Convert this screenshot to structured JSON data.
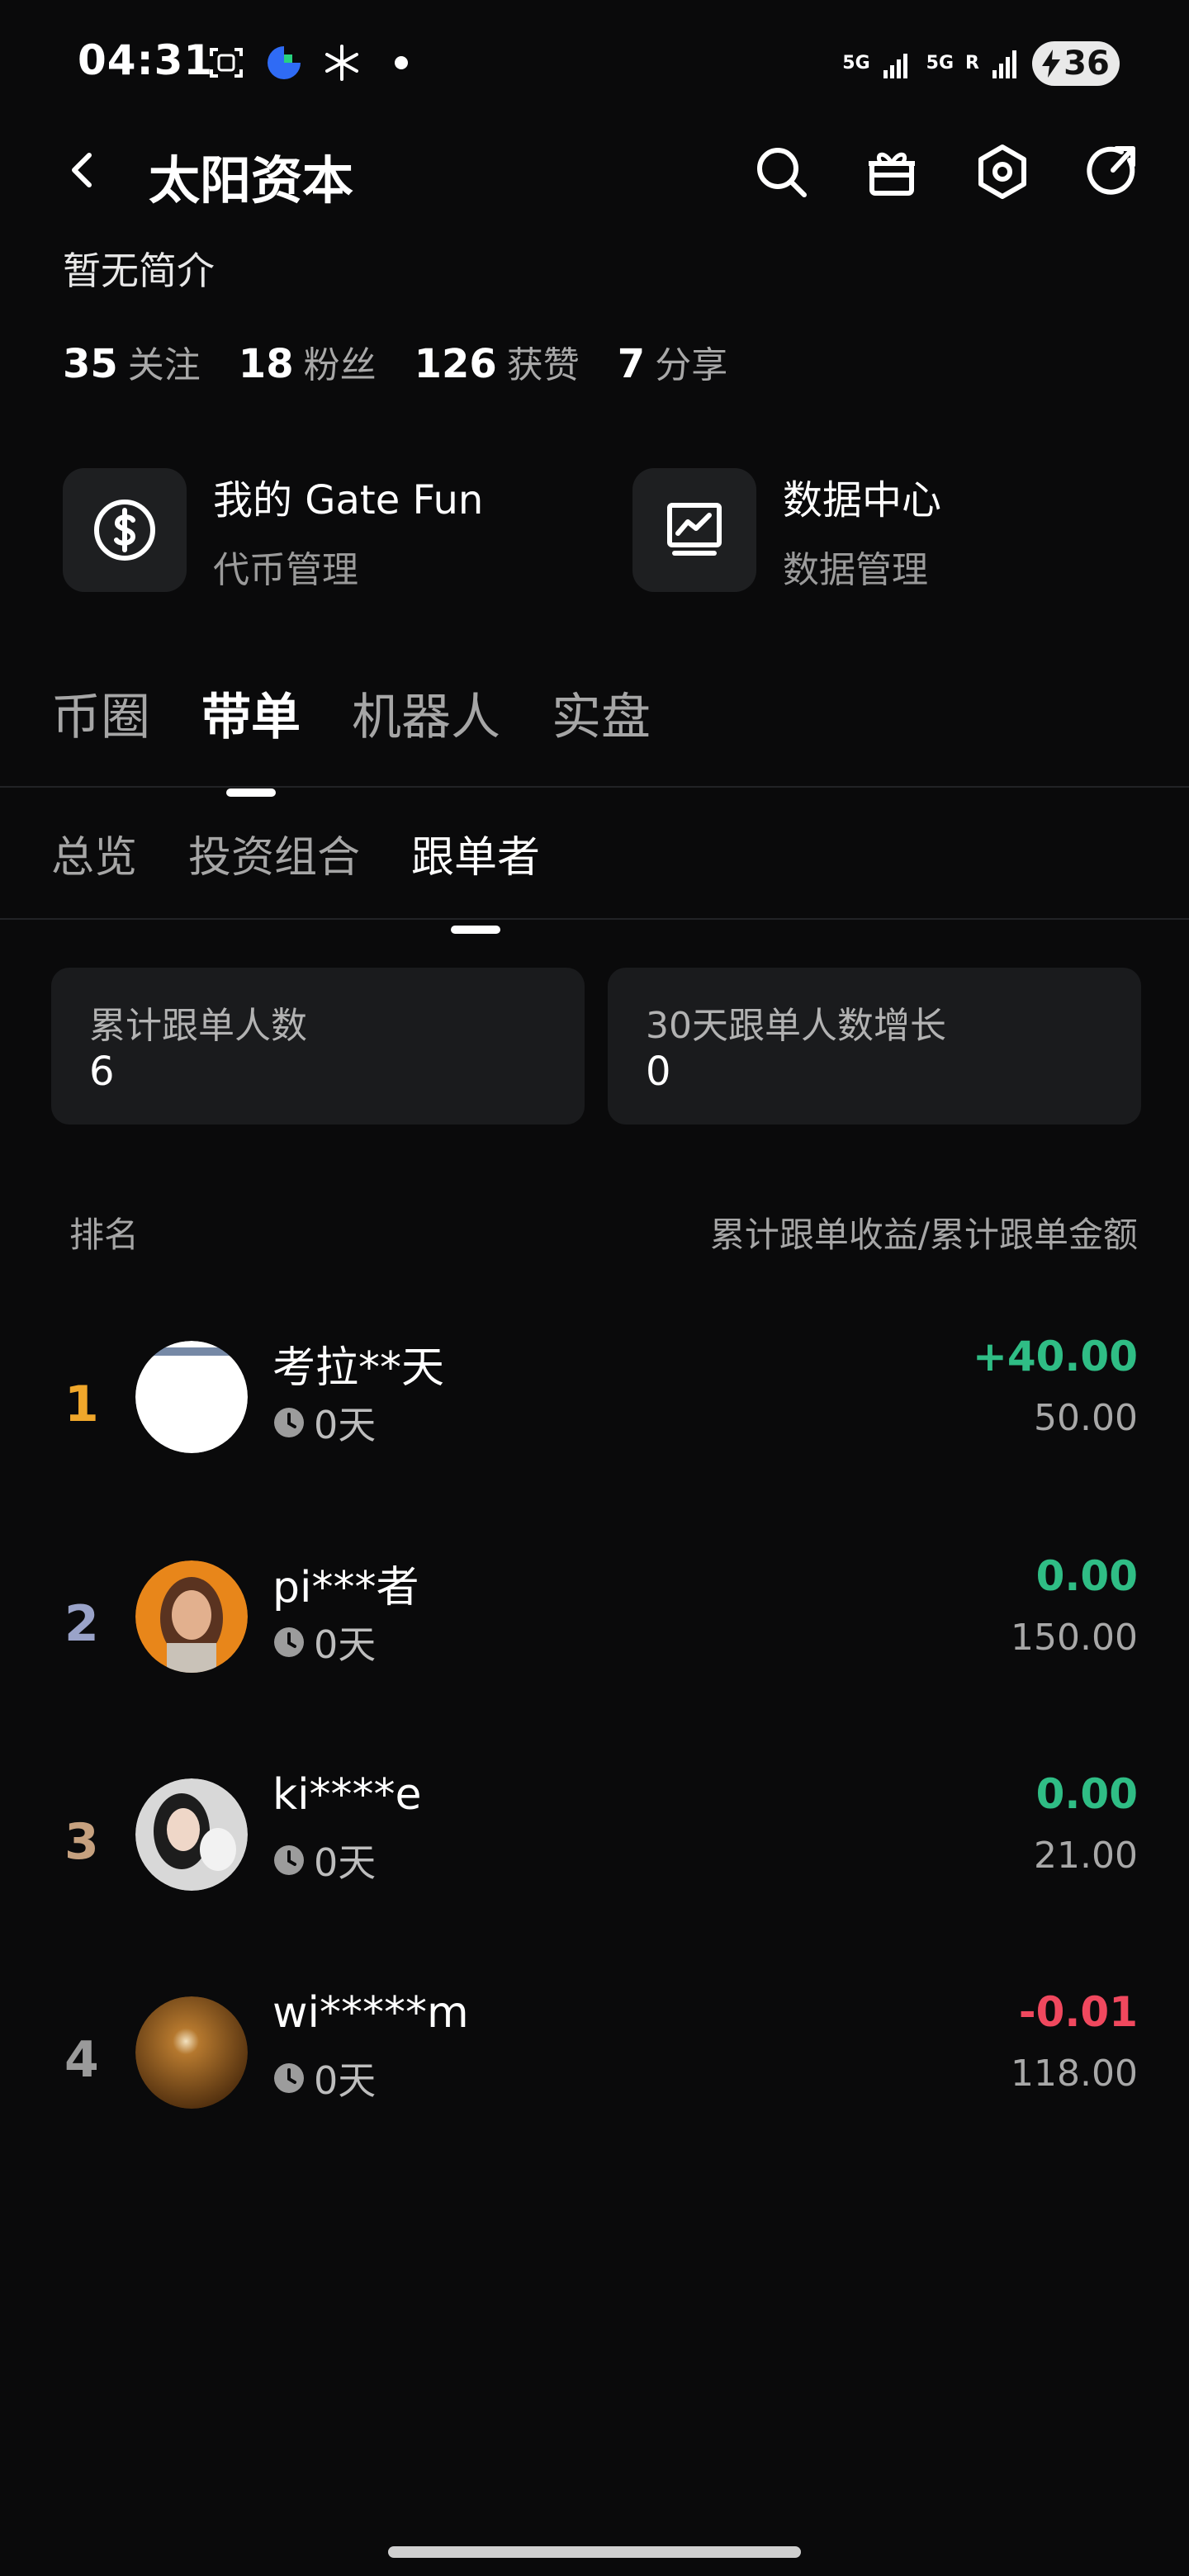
{
  "status_bar": {
    "time": "04:31",
    "network_1": "5G",
    "network_2": "5G",
    "roaming": "R",
    "battery": "36"
  },
  "header": {
    "title": "太阳资本",
    "icons": [
      "back-icon",
      "search-icon",
      "gift-icon",
      "settings-icon",
      "share-icon"
    ]
  },
  "profile": {
    "bio": "暂无简介",
    "stats": [
      {
        "value": "35",
        "label": "关注"
      },
      {
        "value": "18",
        "label": "粉丝"
      },
      {
        "value": "126",
        "label": "获赞"
      },
      {
        "value": "7",
        "label": "分享"
      }
    ]
  },
  "quick_links": [
    {
      "title": "我的 Gate Fun",
      "subtitle": "代币管理",
      "icon": "dollar-circle-icon"
    },
    {
      "title": "数据中心",
      "subtitle": "数据管理",
      "icon": "chart-screen-icon"
    }
  ],
  "main_tabs": [
    {
      "label": "币圈",
      "active": false
    },
    {
      "label": "带单",
      "active": true
    },
    {
      "label": "机器人",
      "active": false
    },
    {
      "label": "实盘",
      "active": false
    }
  ],
  "sub_tabs": [
    {
      "label": "总览",
      "active": false
    },
    {
      "label": "投资组合",
      "active": false
    },
    {
      "label": "跟单者",
      "active": true
    }
  ],
  "summary": [
    {
      "label": "累计跟单人数",
      "value": "6"
    },
    {
      "label": "30天跟单人数增长",
      "value": "0"
    }
  ],
  "table": {
    "rank_header": "排名",
    "value_header": "累计跟单收益/累计跟单金额",
    "rows": [
      {
        "rank": "1",
        "name": "考拉**天",
        "days": "0天",
        "profit": "+40.00",
        "amount": "50.00"
      },
      {
        "rank": "2",
        "name": "pi***者",
        "days": "0天",
        "profit": "0.00",
        "amount": "150.00"
      },
      {
        "rank": "3",
        "name": "ki****e",
        "days": "0天",
        "profit": "0.00",
        "amount": "21.00"
      },
      {
        "rank": "4",
        "name": "wi*****m",
        "days": "0天",
        "profit": "-0.01",
        "amount": "118.00"
      }
    ]
  },
  "colors": {
    "background": "#0a0a0b",
    "positive": "#2fbd85",
    "negative": "#f0485e",
    "rank_1": "#f0a72b",
    "rank_2": "#9aa3c9",
    "rank_3": "#c6a17f",
    "rank_4": "#9a9a9a"
  }
}
